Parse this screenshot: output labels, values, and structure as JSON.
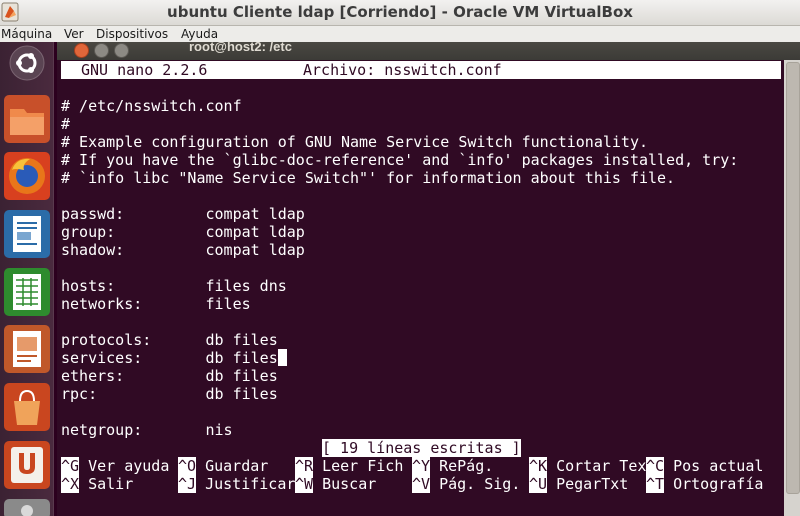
{
  "vbox": {
    "title": "ubuntu Cliente ldap [Corriendo] - Oracle VM VirtualBox",
    "menu": [
      "Máquina",
      "Ver",
      "Dispositivos",
      "Ayuda"
    ]
  },
  "launcher": {
    "items": [
      "ubuntu-dash",
      "files",
      "firefox",
      "writer",
      "calc",
      "impress",
      "software-center",
      "ubuntu-one",
      "settings"
    ]
  },
  "terminal": {
    "title": "root@host2: /etc"
  },
  "nano": {
    "version": "GNU nano 2.2.6",
    "file_label": "Archivo: nsswitch.conf",
    "lines": [
      "# /etc/nsswitch.conf",
      "#",
      "# Example configuration of GNU Name Service Switch functionality.",
      "# If you have the `glibc-doc-reference' and `info' packages installed, try:",
      "# `info libc \"Name Service Switch\"' for information about this file.",
      "",
      "passwd:         compat ldap",
      "group:          compat ldap",
      "shadow:         compat ldap",
      "",
      "hosts:          files dns",
      "networks:       files",
      "",
      "protocols:      db files",
      "services:       db files",
      "ethers:         db files",
      "rpc:            db files",
      "",
      "netgroup:       nis"
    ],
    "status": "[ 19 líneas escritas ]",
    "shortcuts_row1": [
      {
        "key": "^G",
        "label": "Ver ayuda"
      },
      {
        "key": "^O",
        "label": "Guardar"
      },
      {
        "key": "^R",
        "label": "Leer Fich"
      },
      {
        "key": "^Y",
        "label": "RePág."
      },
      {
        "key": "^K",
        "label": "Cortar Tex"
      },
      {
        "key": "^C",
        "label": "Pos actual"
      }
    ],
    "shortcuts_row2": [
      {
        "key": "^X",
        "label": "Salir"
      },
      {
        "key": "^J",
        "label": "Justificar"
      },
      {
        "key": "^W",
        "label": "Buscar"
      },
      {
        "key": "^V",
        "label": "Pág. Sig."
      },
      {
        "key": "^U",
        "label": "PegarTxt"
      },
      {
        "key": "^T",
        "label": "Ortografía"
      }
    ]
  },
  "colors": {
    "terminal_bg": "#300a24",
    "text": "#ffffff",
    "launcher_bg": "#3b2233"
  }
}
